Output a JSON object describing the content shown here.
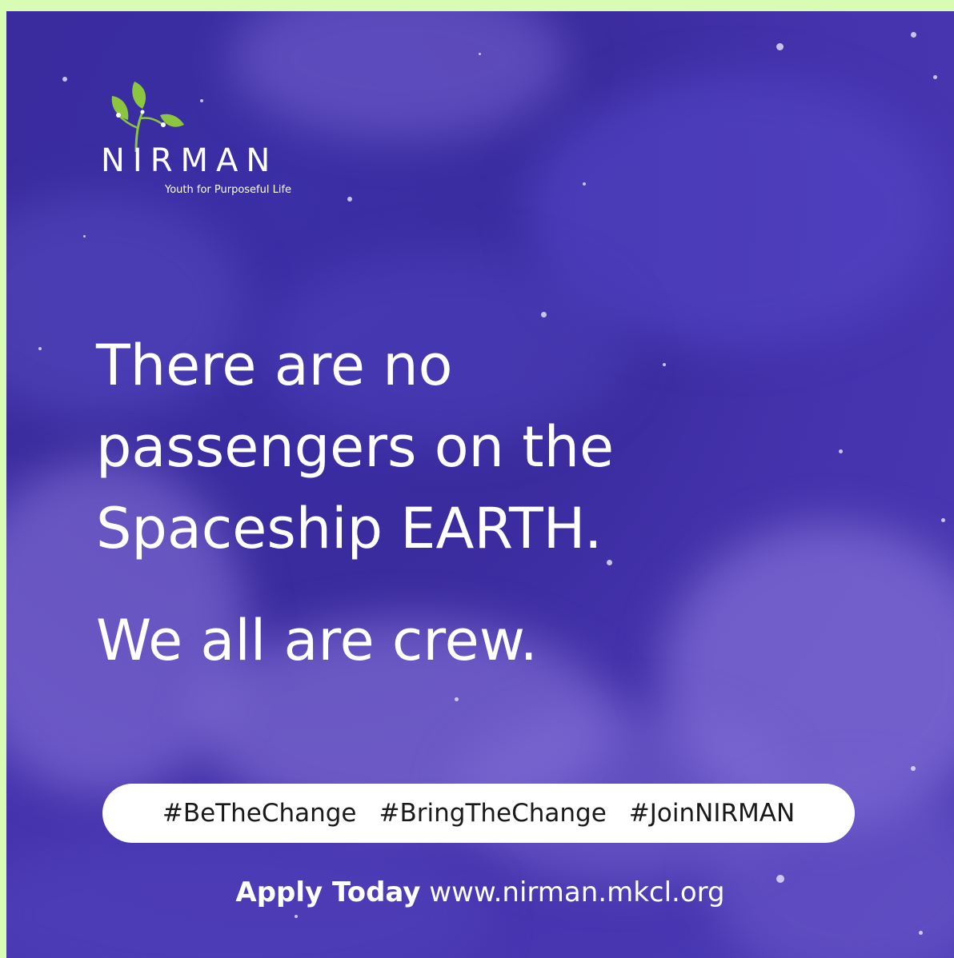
{
  "logo": {
    "wordmark": "NIRMAN",
    "tagline": "Youth for Purposeful Life",
    "icon": "sprout-icon",
    "leaf_color": "#8cc63f"
  },
  "headline": {
    "line1": "There are no",
    "line2": "passengers on the",
    "line3": "Spaceship EARTH."
  },
  "subline": "We all are crew.",
  "hashtags": [
    "#BeTheChange",
    "#BringTheChange",
    "#JoinNIRMAN"
  ],
  "footer": {
    "cta": "Apply Today",
    "url": "www.nirman.mkcl.org"
  },
  "colors": {
    "background": "#3d2fa3",
    "page_border": "#d8fcb4",
    "text": "#ffffff",
    "pill": "#ffffff"
  }
}
